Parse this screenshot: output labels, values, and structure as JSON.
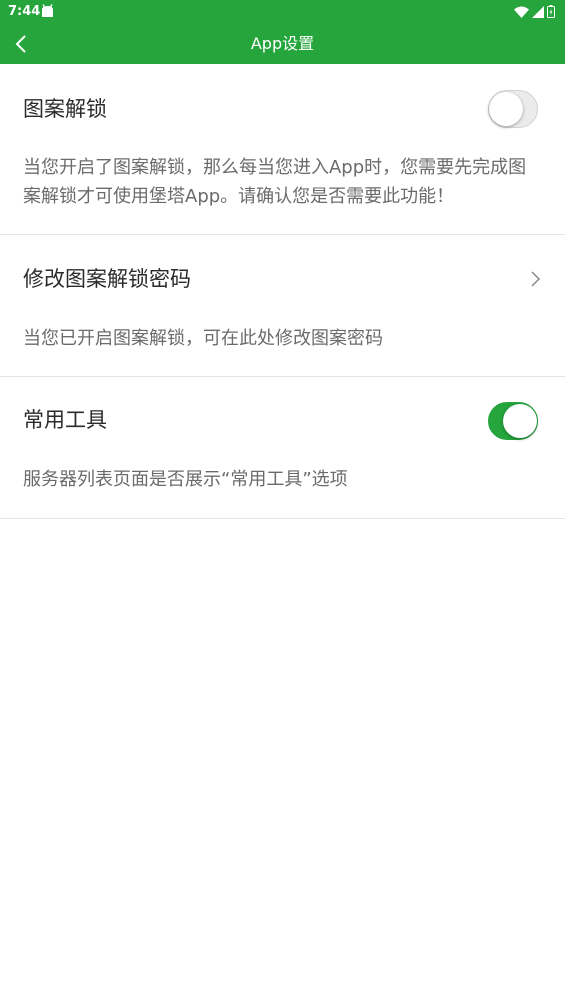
{
  "status_bar": {
    "time": "7:44",
    "icons": [
      "android-icon",
      "wifi-icon",
      "cell-signal-icon",
      "battery-icon"
    ]
  },
  "header": {
    "title": "App设置",
    "back_icon": "back-arrow-icon"
  },
  "settings": [
    {
      "title": "图案解锁",
      "description": "当您开启了图案解锁，那么每当您进入App时，您需要先完成图案解锁才可使用堡塔App。请确认您是否需要此功能！",
      "control": "toggle",
      "enabled": false
    },
    {
      "title": "修改图案解锁密码",
      "description": "当您已开启图案解锁，可在此处修改图案密码",
      "control": "chevron-right-icon"
    },
    {
      "title": "常用工具",
      "description": "服务器列表页面是否展示“常用工具”选项",
      "control": "toggle",
      "enabled": true
    }
  ],
  "colors": {
    "brand": "#25a53c",
    "title_text": "#2b2b2b",
    "desc_text": "#6b6b6b",
    "divider": "#e5e5e5"
  }
}
